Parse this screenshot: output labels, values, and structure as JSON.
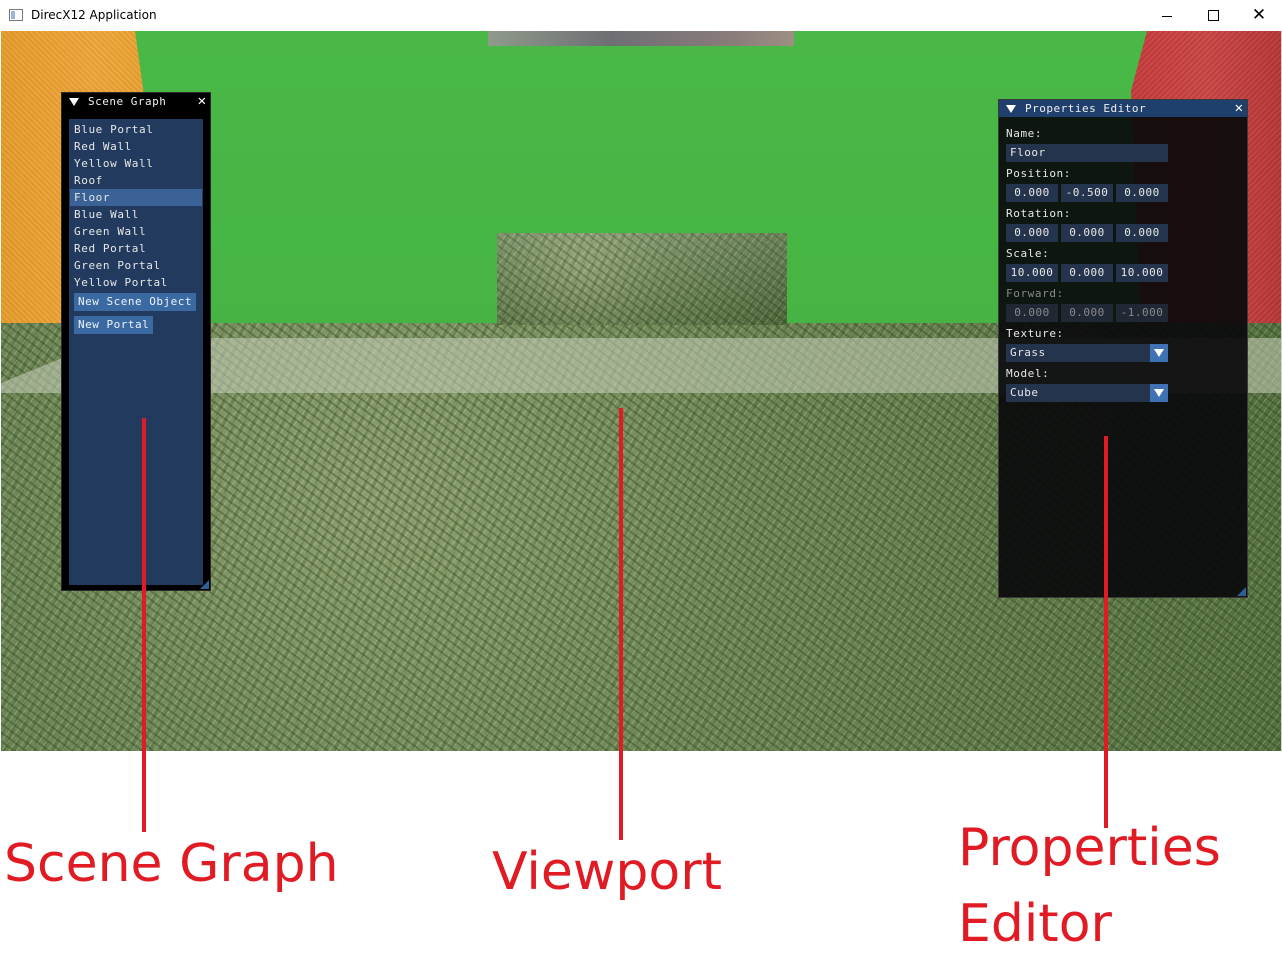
{
  "window": {
    "title": "DirecX12 Application"
  },
  "scene_graph": {
    "title": "Scene Graph",
    "items": [
      {
        "label": "Blue Portal",
        "selected": false
      },
      {
        "label": "Red Wall",
        "selected": false
      },
      {
        "label": "Yellow Wall",
        "selected": false
      },
      {
        "label": "Roof",
        "selected": false
      },
      {
        "label": "Floor",
        "selected": true
      },
      {
        "label": "Blue Wall",
        "selected": false
      },
      {
        "label": "Green Wall",
        "selected": false
      },
      {
        "label": "Red Portal",
        "selected": false
      },
      {
        "label": "Green Portal",
        "selected": false
      },
      {
        "label": "Yellow Portal",
        "selected": false
      }
    ],
    "new_scene_object_label": "New Scene Object",
    "new_portal_label": "New Portal"
  },
  "properties": {
    "title": "Properties Editor",
    "name_label": "Name:",
    "name_value": "Floor",
    "position_label": "Position:",
    "position": [
      "0.000",
      "-0.500",
      "0.000"
    ],
    "rotation_label": "Rotation:",
    "rotation": [
      "0.000",
      "0.000",
      "0.000"
    ],
    "scale_label": "Scale:",
    "scale": [
      "10.000",
      "0.000",
      "10.000"
    ],
    "forward_label": "Forward:",
    "forward": [
      "0.000",
      "0.000",
      "-1.000"
    ],
    "texture_label": "Texture:",
    "texture_value": "Grass",
    "model_label": "Model:",
    "model_value": "Cube"
  },
  "annotations": {
    "scene_graph": "Scene Graph",
    "viewport": "Viewport",
    "properties_line1": "Properties",
    "properties_line2": "Editor"
  },
  "colors": {
    "annotation": "#e01b24",
    "back_wall": "#46b544",
    "left_wall": "#f0a63a",
    "right_wall": "#cc4545",
    "imgui_accent": "#3b6aa3"
  },
  "icons": {
    "app": "app-window-icon",
    "minimize": "minimize-icon",
    "maximize": "maximize-icon",
    "close": "close-icon",
    "collapse": "collapse-triangle-icon",
    "dropdown": "dropdown-arrow-icon"
  }
}
